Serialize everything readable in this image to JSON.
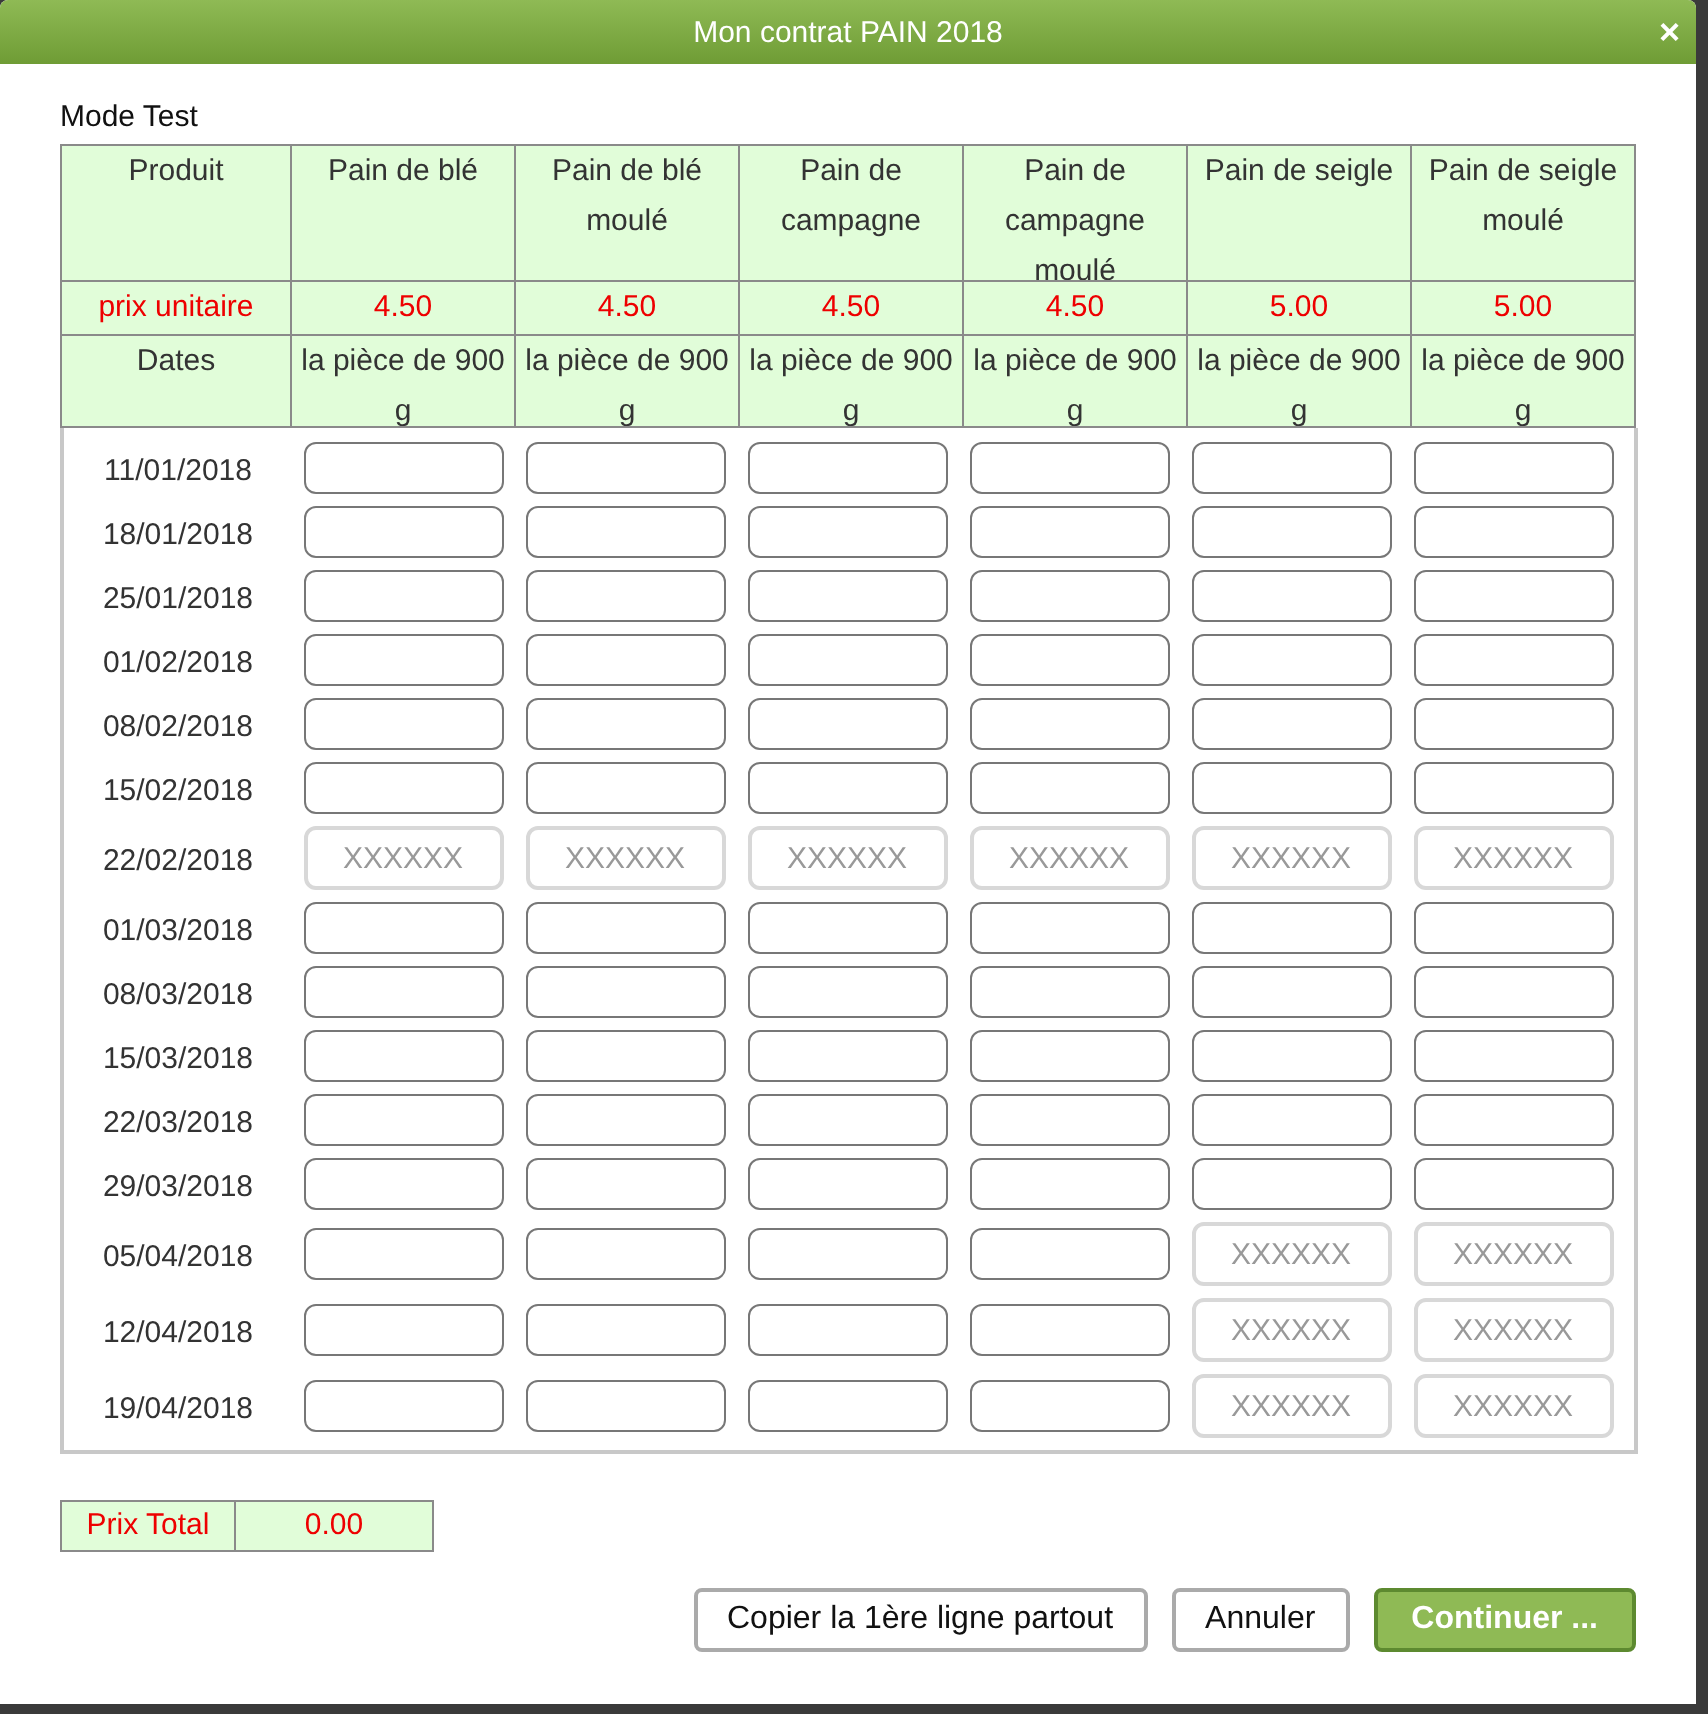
{
  "dialog": {
    "title": "Mon contrat PAIN 2018",
    "close": "×"
  },
  "mode": "Mode Test",
  "header": {
    "product_label": "Produit",
    "price_label": "prix unitaire",
    "dates_label": "Dates",
    "products": [
      {
        "name": "Pain de blé",
        "price": "4.50",
        "unit": "la pièce de 900 g"
      },
      {
        "name": "Pain de blé moulé",
        "price": "4.50",
        "unit": "la pièce de 900 g"
      },
      {
        "name": "Pain de campagne",
        "price": "4.50",
        "unit": "la pièce de 900 g"
      },
      {
        "name": "Pain de campagne moulé",
        "price": "4.50",
        "unit": "la pièce de 900 g"
      },
      {
        "name": "Pain de seigle",
        "price": "5.00",
        "unit": "la pièce de 900 g"
      },
      {
        "name": "Pain de seigle moulé",
        "price": "5.00",
        "unit": "la pièce de 900 g"
      }
    ]
  },
  "rows": [
    {
      "date": "11/01/2018",
      "cells": [
        {
          "disabled": false
        },
        {
          "disabled": false
        },
        {
          "disabled": false
        },
        {
          "disabled": false
        },
        {
          "disabled": false
        },
        {
          "disabled": false
        }
      ]
    },
    {
      "date": "18/01/2018",
      "cells": [
        {
          "disabled": false
        },
        {
          "disabled": false
        },
        {
          "disabled": false
        },
        {
          "disabled": false
        },
        {
          "disabled": false
        },
        {
          "disabled": false
        }
      ]
    },
    {
      "date": "25/01/2018",
      "cells": [
        {
          "disabled": false
        },
        {
          "disabled": false
        },
        {
          "disabled": false
        },
        {
          "disabled": false
        },
        {
          "disabled": false
        },
        {
          "disabled": false
        }
      ]
    },
    {
      "date": "01/02/2018",
      "cells": [
        {
          "disabled": false
        },
        {
          "disabled": false
        },
        {
          "disabled": false
        },
        {
          "disabled": false
        },
        {
          "disabled": false
        },
        {
          "disabled": false
        }
      ]
    },
    {
      "date": "08/02/2018",
      "cells": [
        {
          "disabled": false
        },
        {
          "disabled": false
        },
        {
          "disabled": false
        },
        {
          "disabled": false
        },
        {
          "disabled": false
        },
        {
          "disabled": false
        }
      ]
    },
    {
      "date": "15/02/2018",
      "cells": [
        {
          "disabled": false
        },
        {
          "disabled": false
        },
        {
          "disabled": false
        },
        {
          "disabled": false
        },
        {
          "disabled": false
        },
        {
          "disabled": false
        }
      ]
    },
    {
      "date": "22/02/2018",
      "cells": [
        {
          "disabled": true,
          "placeholder": "XXXXXX"
        },
        {
          "disabled": true,
          "placeholder": "XXXXXX"
        },
        {
          "disabled": true,
          "placeholder": "XXXXXX"
        },
        {
          "disabled": true,
          "placeholder": "XXXXXX"
        },
        {
          "disabled": true,
          "placeholder": "XXXXXX"
        },
        {
          "disabled": true,
          "placeholder": "XXXXXX"
        }
      ]
    },
    {
      "date": "01/03/2018",
      "cells": [
        {
          "disabled": false
        },
        {
          "disabled": false
        },
        {
          "disabled": false
        },
        {
          "disabled": false
        },
        {
          "disabled": false
        },
        {
          "disabled": false
        }
      ]
    },
    {
      "date": "08/03/2018",
      "cells": [
        {
          "disabled": false
        },
        {
          "disabled": false
        },
        {
          "disabled": false
        },
        {
          "disabled": false
        },
        {
          "disabled": false
        },
        {
          "disabled": false
        }
      ]
    },
    {
      "date": "15/03/2018",
      "cells": [
        {
          "disabled": false
        },
        {
          "disabled": false
        },
        {
          "disabled": false
        },
        {
          "disabled": false
        },
        {
          "disabled": false
        },
        {
          "disabled": false
        }
      ]
    },
    {
      "date": "22/03/2018",
      "cells": [
        {
          "disabled": false
        },
        {
          "disabled": false
        },
        {
          "disabled": false
        },
        {
          "disabled": false
        },
        {
          "disabled": false
        },
        {
          "disabled": false
        }
      ]
    },
    {
      "date": "29/03/2018",
      "cells": [
        {
          "disabled": false
        },
        {
          "disabled": false
        },
        {
          "disabled": false
        },
        {
          "disabled": false
        },
        {
          "disabled": false
        },
        {
          "disabled": false
        }
      ]
    },
    {
      "date": "05/04/2018",
      "cells": [
        {
          "disabled": false
        },
        {
          "disabled": false
        },
        {
          "disabled": false
        },
        {
          "disabled": false
        },
        {
          "disabled": true,
          "placeholder": "XXXXXX"
        },
        {
          "disabled": true,
          "placeholder": "XXXXXX"
        }
      ]
    },
    {
      "date": "12/04/2018",
      "cells": [
        {
          "disabled": false
        },
        {
          "disabled": false
        },
        {
          "disabled": false
        },
        {
          "disabled": false
        },
        {
          "disabled": true,
          "placeholder": "XXXXXX"
        },
        {
          "disabled": true,
          "placeholder": "XXXXXX"
        }
      ]
    },
    {
      "date": "19/04/2018",
      "cells": [
        {
          "disabled": false
        },
        {
          "disabled": false
        },
        {
          "disabled": false
        },
        {
          "disabled": false
        },
        {
          "disabled": true,
          "placeholder": "XXXXXX"
        },
        {
          "disabled": true,
          "placeholder": "XXXXXX"
        }
      ]
    }
  ],
  "total": {
    "label": "Prix Total",
    "value": "0.00"
  },
  "buttons": [
    {
      "label": "Copier la 1ère ligne partout",
      "kind": "secondary"
    },
    {
      "label": "Annuler",
      "kind": "secondary"
    },
    {
      "label": "Continuer ...",
      "kind": "primary"
    }
  ]
}
